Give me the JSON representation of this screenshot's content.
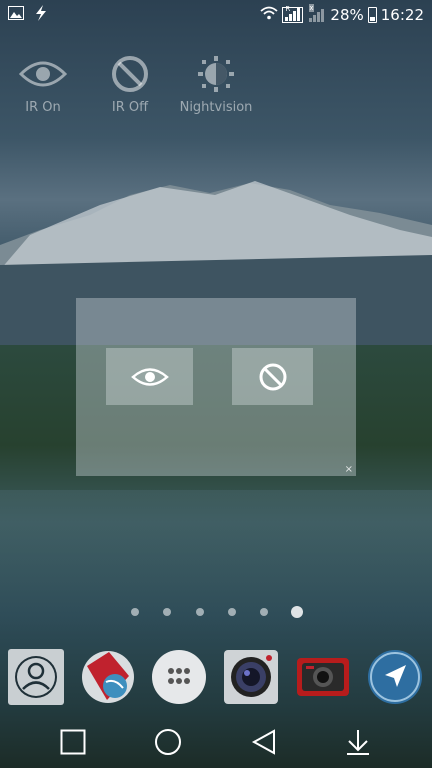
{
  "status_bar": {
    "battery_percent": "28%",
    "time": "16:22",
    "sim1_tag": "R",
    "sim2_tag": "x",
    "icons": [
      "image-icon",
      "flash-icon",
      "wifi-icon",
      "signal-icon",
      "signal-icon",
      "battery-icon"
    ]
  },
  "quick_actions": [
    {
      "label": "IR On",
      "icon": "eye-icon"
    },
    {
      "label": "IR Off",
      "icon": "block-icon"
    },
    {
      "label": "Nightvision",
      "icon": "nightvision-icon"
    }
  ],
  "dialog": {
    "buttons": [
      {
        "icon": "eye-icon"
      },
      {
        "icon": "block-icon"
      }
    ],
    "close_glyph": "×"
  },
  "page_indicator": {
    "count": 6,
    "active_index": 5
  },
  "dock_apps": [
    {
      "icon": "contacts-icon"
    },
    {
      "icon": "browser-icon"
    },
    {
      "icon": "app-drawer-icon"
    },
    {
      "icon": "camera-icon"
    },
    {
      "icon": "video-camera-icon"
    },
    {
      "icon": "navigation-icon"
    }
  ],
  "nav_bar": [
    {
      "icon": "recents-icon"
    },
    {
      "icon": "home-icon"
    },
    {
      "icon": "back-icon"
    },
    {
      "icon": "notification-pull-icon"
    }
  ],
  "colors": {
    "overlay_text": "#ffffff",
    "dim_text": "rgba(255,255,255,0.5)",
    "browser_red": "#c0222e",
    "nav_blue": "#2e6ea1"
  }
}
